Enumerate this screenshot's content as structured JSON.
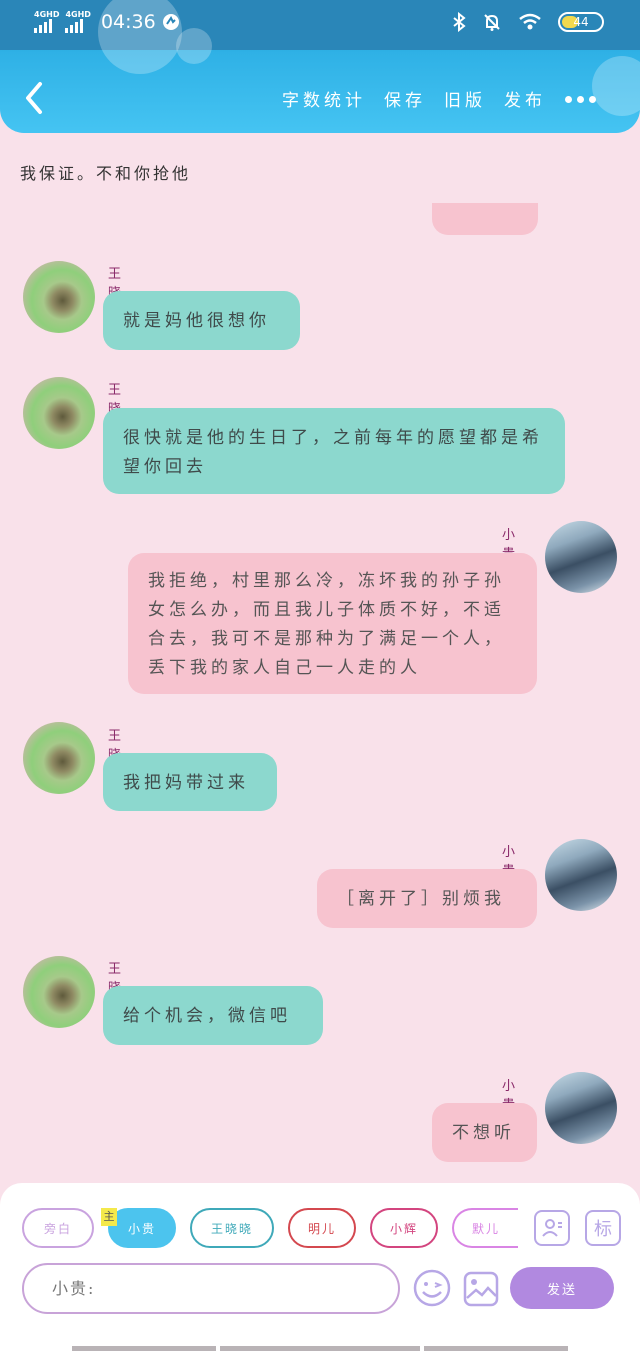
{
  "status": {
    "sig1": "4GHD",
    "sig2": "4GHD",
    "time": "04:36",
    "battery": "44"
  },
  "header": {
    "nav": [
      "字数统计",
      "保存",
      "旧版",
      "发布"
    ]
  },
  "notice": "我保证。不和你抢他",
  "messages": [
    {
      "side": "left",
      "name": "王晓晓",
      "text": "就是妈他很想你"
    },
    {
      "side": "left",
      "name": "王晓晓",
      "text": "很快就是他的生日了，之前每年的愿望都是希望你回去"
    },
    {
      "side": "right",
      "name": "小贵",
      "text": "我拒绝，村里那么冷，冻坏我的孙子孙女怎么办，而且我儿子体质不好，不适合去，我可不是那种为了满足一个人，丢下我的家人自己一人走的人"
    },
    {
      "side": "left",
      "name": "王晓晓",
      "text": "我把妈带过来"
    },
    {
      "side": "right",
      "name": "小贵",
      "text": "［离开了］别烦我"
    },
    {
      "side": "left",
      "name": "王晓晓",
      "text": "给个机会，微信吧"
    },
    {
      "side": "right",
      "name": "小贵",
      "text": "不想听"
    }
  ],
  "characters": {
    "main_tag": "主",
    "chips": [
      "旁白",
      "小贵",
      "王晓晓",
      "明儿",
      "小辉",
      "默儿"
    ],
    "colors": [
      "#c9a3df",
      "#4cc4ee",
      "#3fa9b9",
      "#d4484f",
      "#d3457f",
      "#d985e4"
    ]
  },
  "input": {
    "placeholder": "小贵:"
  },
  "send_label": "发送",
  "mark_label": "标"
}
